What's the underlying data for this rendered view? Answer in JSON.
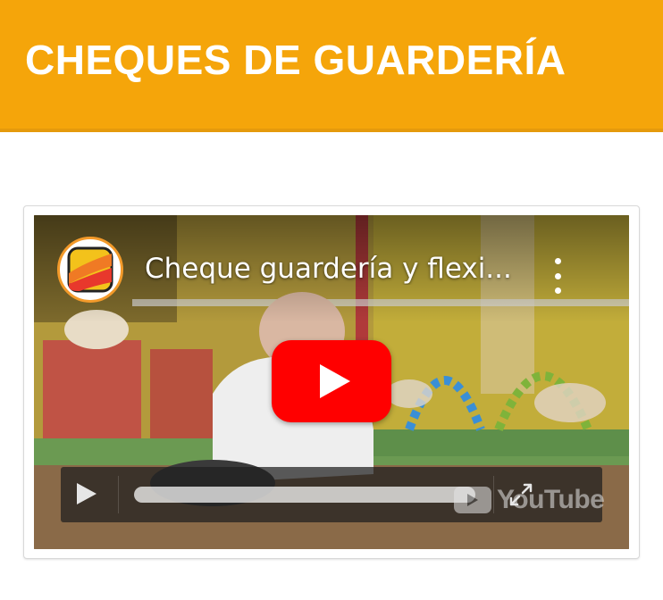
{
  "header": {
    "title": "CHEQUES DE GUARDERÍA",
    "bg_color": "#f5a50a"
  },
  "video": {
    "title": "Cheque guardería y flexi...",
    "channel_logo_icon": "channel-logo-icon",
    "more_icon": "more-vertical-icon",
    "play_icon": "youtube-play-icon",
    "watermark_text": "YouTube",
    "fullscreen_icon": "fullscreen-icon",
    "play_button_color": "#ff0000"
  }
}
